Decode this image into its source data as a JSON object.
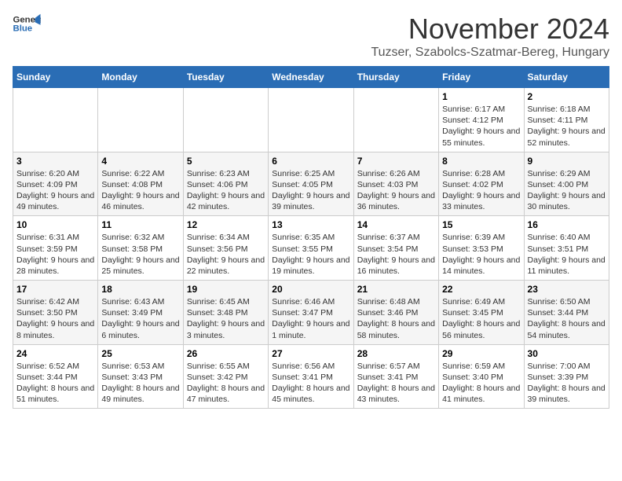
{
  "logo": {
    "line1": "General",
    "line2": "Blue"
  },
  "title": "November 2024",
  "location": "Tuzser, Szabolcs-Szatmar-Bereg, Hungary",
  "days_of_week": [
    "Sunday",
    "Monday",
    "Tuesday",
    "Wednesday",
    "Thursday",
    "Friday",
    "Saturday"
  ],
  "weeks": [
    [
      {
        "day": "",
        "info": ""
      },
      {
        "day": "",
        "info": ""
      },
      {
        "day": "",
        "info": ""
      },
      {
        "day": "",
        "info": ""
      },
      {
        "day": "",
        "info": ""
      },
      {
        "day": "1",
        "info": "Sunrise: 6:17 AM\nSunset: 4:12 PM\nDaylight: 9 hours and 55 minutes."
      },
      {
        "day": "2",
        "info": "Sunrise: 6:18 AM\nSunset: 4:11 PM\nDaylight: 9 hours and 52 minutes."
      }
    ],
    [
      {
        "day": "3",
        "info": "Sunrise: 6:20 AM\nSunset: 4:09 PM\nDaylight: 9 hours and 49 minutes."
      },
      {
        "day": "4",
        "info": "Sunrise: 6:22 AM\nSunset: 4:08 PM\nDaylight: 9 hours and 46 minutes."
      },
      {
        "day": "5",
        "info": "Sunrise: 6:23 AM\nSunset: 4:06 PM\nDaylight: 9 hours and 42 minutes."
      },
      {
        "day": "6",
        "info": "Sunrise: 6:25 AM\nSunset: 4:05 PM\nDaylight: 9 hours and 39 minutes."
      },
      {
        "day": "7",
        "info": "Sunrise: 6:26 AM\nSunset: 4:03 PM\nDaylight: 9 hours and 36 minutes."
      },
      {
        "day": "8",
        "info": "Sunrise: 6:28 AM\nSunset: 4:02 PM\nDaylight: 9 hours and 33 minutes."
      },
      {
        "day": "9",
        "info": "Sunrise: 6:29 AM\nSunset: 4:00 PM\nDaylight: 9 hours and 30 minutes."
      }
    ],
    [
      {
        "day": "10",
        "info": "Sunrise: 6:31 AM\nSunset: 3:59 PM\nDaylight: 9 hours and 28 minutes."
      },
      {
        "day": "11",
        "info": "Sunrise: 6:32 AM\nSunset: 3:58 PM\nDaylight: 9 hours and 25 minutes."
      },
      {
        "day": "12",
        "info": "Sunrise: 6:34 AM\nSunset: 3:56 PM\nDaylight: 9 hours and 22 minutes."
      },
      {
        "day": "13",
        "info": "Sunrise: 6:35 AM\nSunset: 3:55 PM\nDaylight: 9 hours and 19 minutes."
      },
      {
        "day": "14",
        "info": "Sunrise: 6:37 AM\nSunset: 3:54 PM\nDaylight: 9 hours and 16 minutes."
      },
      {
        "day": "15",
        "info": "Sunrise: 6:39 AM\nSunset: 3:53 PM\nDaylight: 9 hours and 14 minutes."
      },
      {
        "day": "16",
        "info": "Sunrise: 6:40 AM\nSunset: 3:51 PM\nDaylight: 9 hours and 11 minutes."
      }
    ],
    [
      {
        "day": "17",
        "info": "Sunrise: 6:42 AM\nSunset: 3:50 PM\nDaylight: 9 hours and 8 minutes."
      },
      {
        "day": "18",
        "info": "Sunrise: 6:43 AM\nSunset: 3:49 PM\nDaylight: 9 hours and 6 minutes."
      },
      {
        "day": "19",
        "info": "Sunrise: 6:45 AM\nSunset: 3:48 PM\nDaylight: 9 hours and 3 minutes."
      },
      {
        "day": "20",
        "info": "Sunrise: 6:46 AM\nSunset: 3:47 PM\nDaylight: 9 hours and 1 minute."
      },
      {
        "day": "21",
        "info": "Sunrise: 6:48 AM\nSunset: 3:46 PM\nDaylight: 8 hours and 58 minutes."
      },
      {
        "day": "22",
        "info": "Sunrise: 6:49 AM\nSunset: 3:45 PM\nDaylight: 8 hours and 56 minutes."
      },
      {
        "day": "23",
        "info": "Sunrise: 6:50 AM\nSunset: 3:44 PM\nDaylight: 8 hours and 54 minutes."
      }
    ],
    [
      {
        "day": "24",
        "info": "Sunrise: 6:52 AM\nSunset: 3:44 PM\nDaylight: 8 hours and 51 minutes."
      },
      {
        "day": "25",
        "info": "Sunrise: 6:53 AM\nSunset: 3:43 PM\nDaylight: 8 hours and 49 minutes."
      },
      {
        "day": "26",
        "info": "Sunrise: 6:55 AM\nSunset: 3:42 PM\nDaylight: 8 hours and 47 minutes."
      },
      {
        "day": "27",
        "info": "Sunrise: 6:56 AM\nSunset: 3:41 PM\nDaylight: 8 hours and 45 minutes."
      },
      {
        "day": "28",
        "info": "Sunrise: 6:57 AM\nSunset: 3:41 PM\nDaylight: 8 hours and 43 minutes."
      },
      {
        "day": "29",
        "info": "Sunrise: 6:59 AM\nSunset: 3:40 PM\nDaylight: 8 hours and 41 minutes."
      },
      {
        "day": "30",
        "info": "Sunrise: 7:00 AM\nSunset: 3:39 PM\nDaylight: 8 hours and 39 minutes."
      }
    ]
  ]
}
